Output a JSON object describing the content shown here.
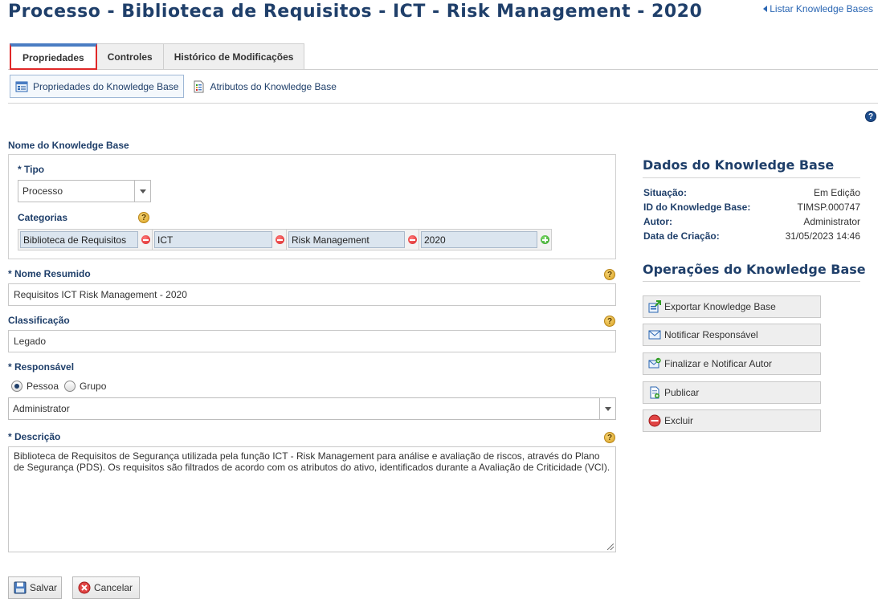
{
  "page": {
    "title": "Processo - Biblioteca de Requisitos - ICT - Risk Management - 2020",
    "back_link": "Listar Knowledge Bases"
  },
  "tabs": [
    {
      "label": "Propriedades",
      "active": true
    },
    {
      "label": "Controles",
      "active": false
    },
    {
      "label": "Histórico de Modificações",
      "active": false
    }
  ],
  "subtabs": [
    {
      "label": "Propriedades do Knowledge Base",
      "active": true
    },
    {
      "label": "Atributos do Knowledge Base",
      "active": false
    }
  ],
  "form": {
    "section_title": "Nome do Knowledge Base",
    "tipo": {
      "label": "* Tipo",
      "value": "Processo"
    },
    "categorias": {
      "label": "Categorias",
      "items": [
        "Biblioteca de Requisitos",
        "ICT",
        "Risk Management",
        "2020"
      ]
    },
    "nome_resumido": {
      "label": "* Nome Resumido",
      "value": "Requisitos ICT Risk Management - 2020"
    },
    "classificacao": {
      "label": "Classificação",
      "value": "Legado"
    },
    "responsavel": {
      "label": "* Responsável",
      "option_pessoa": "Pessoa",
      "option_grupo": "Grupo",
      "selected": "Pessoa",
      "value": "Administrator"
    },
    "descricao": {
      "label": "* Descrição",
      "value": "Biblioteca de Requisitos de Segurança utilizada pela função ICT - Risk Management para análise e avaliação de riscos, através do Plano de Segurança (PDS). Os requisitos são filtrados de acordo com os atributos do ativo, identificados durante a Avaliação de Criticidade (VCI)."
    },
    "save_label": "Salvar",
    "cancel_label": "Cancelar"
  },
  "sidebar": {
    "data_title": "Dados do Knowledge Base",
    "fields": [
      {
        "key": "Situação:",
        "value": "Em Edição"
      },
      {
        "key": "ID do Knowledge Base:",
        "value": "TIMSP.000747"
      },
      {
        "key": "Autor:",
        "value": "Administrator"
      },
      {
        "key": "Data de Criação:",
        "value": "31/05/2023 14:46"
      }
    ],
    "ops_title": "Operações do Knowledge Base",
    "operations": [
      {
        "label": "Exportar Knowledge Base",
        "icon": "export-icon"
      },
      {
        "label": "Notificar Responsável",
        "icon": "mail-icon"
      },
      {
        "label": "Finalizar e Notificar Autor",
        "icon": "mail-check-icon"
      },
      {
        "label": "Publicar",
        "icon": "publish-icon"
      },
      {
        "label": "Excluir",
        "icon": "delete-icon"
      }
    ]
  },
  "colors": {
    "title": "#1f3f6a",
    "link": "#2a66b3",
    "active_tab_border": "#e02828",
    "active_tab_top": "#4a7dc3"
  }
}
